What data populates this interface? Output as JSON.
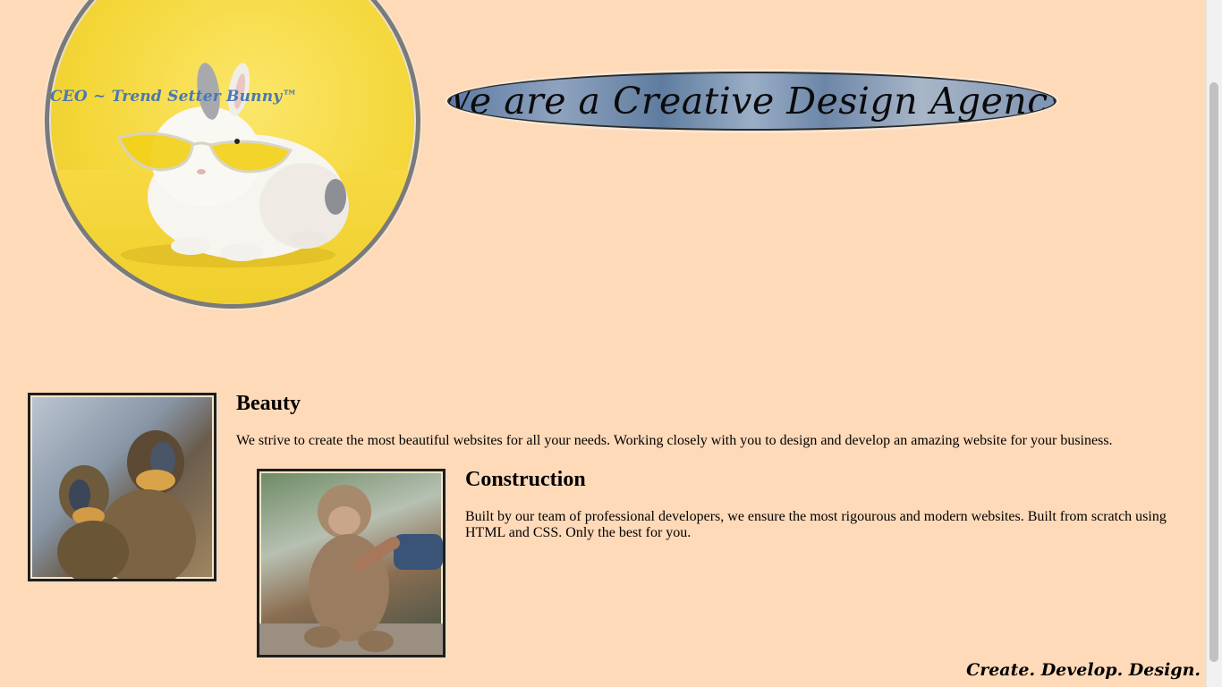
{
  "hero": {
    "caption": "CEO ~ Trend Setter Bunny™",
    "image_desc": "white bunny wearing yellow sunglasses on yellow background"
  },
  "banner": {
    "title": "We are a Creative Design Agency"
  },
  "features": [
    {
      "title": "Beauty",
      "text": "We strive to create the most beautiful websites for all your needs. Working closely with you to design and develop an amazing website for your business.",
      "image_desc": "two mandrill monkeys"
    },
    {
      "title": "Construction",
      "text": "Built by our team of professional developers, we ensure the most rigourous and modern websites. Built from scratch using HTML and CSS. Only the best for you.",
      "image_desc": "macaque monkey holding a human hand"
    }
  ],
  "footer": {
    "tagline": "Create. Develop. Design."
  },
  "colors": {
    "background": "#ffdab9",
    "caption": "#4a78b3",
    "hero_yellow": "#f4d637"
  }
}
